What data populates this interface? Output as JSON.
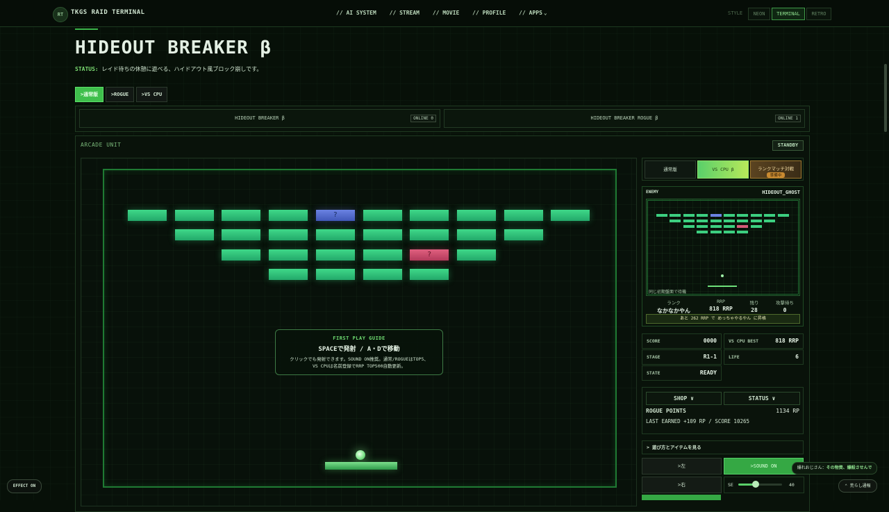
{
  "header": {
    "logo_badge": "RT",
    "site_name": "TKGS RAID TERMINAL",
    "nav": [
      "// AI SYSTEM",
      "// STREAM",
      "// MOVIE",
      "// PROFILE",
      "// APPS"
    ],
    "style_label": "STYLE",
    "style_options": [
      "NEON",
      "TERMINAL",
      "RETRO"
    ],
    "style_active": "TERMINAL"
  },
  "page": {
    "title": "HIDEOUT BREAKER β",
    "status_label": "STATUS:",
    "status_text": "レイド待ちの休憩に遊べる、ハイドアウト風ブロック崩しです。",
    "modes": [
      ">通常版",
      ">ROGUE",
      ">VS CPU"
    ],
    "active_mode": ">通常版"
  },
  "online": [
    {
      "name": "HIDEOUT BREAKER β",
      "badge": "ONLINE 0"
    },
    {
      "name": "HIDEOUT BREAKER ROGUE β",
      "badge": "ONLINE 1"
    }
  ],
  "arcade": {
    "title": "ARCADE UNIT",
    "state_badge": "STANDBY",
    "guide": {
      "heading": "FIRST PLAY GUIDE",
      "controls": "SPACEで発射 / A・Dで移動",
      "line1": "クリックでも発射できます。SOUND ON推奨。通常/ROGUEはTOP5、",
      "line2": "VS CPUは名前登録でRRP TOP500自動更新。"
    },
    "special_mark": "?"
  },
  "right_panel": {
    "tabs": [
      "通常版",
      "VS CPU β",
      "ランクマッチ対戦"
    ],
    "rank_sub": "準備中",
    "enemy_label": "ENEMY",
    "enemy_name": "HIDEOUT_GHOST",
    "minimap_note": "同じ初期盤面で待機",
    "enemy_stats": [
      {
        "label": "ランク",
        "value": "なかなかやん"
      },
      {
        "label": "RRP",
        "value": "818 RRP"
      },
      {
        "label": "残り",
        "value": "28"
      },
      {
        "label": "攻撃待ち",
        "value": "0"
      }
    ],
    "rank_progress": "あと 262 RRP で めっちゃやるやん に昇格",
    "stats": [
      {
        "label": "SCORE",
        "value": "0000"
      },
      {
        "label": "VS CPU BEST",
        "value": "818 RRP"
      },
      {
        "label": "STAGE",
        "value": "R1-1"
      },
      {
        "label": "LIFE",
        "value": "6"
      },
      {
        "label": "STATE",
        "value": "READY"
      }
    ],
    "shop_label": "SHOP ∨",
    "status_label": "STATUS ∨",
    "rogue_points_label": "ROGUE POINTS",
    "rogue_points_value": "1134 RP",
    "last_earned": "LAST EARNED +109 RP / SCORE 10265",
    "howto": "> 遊び方とアイテムを見る",
    "controls": {
      "left": ">左",
      "sound": ">SOUND ON",
      "right": ">右",
      "se_label": "SE",
      "se_value": "40",
      "se_level": 0.4
    }
  },
  "overlays": {
    "effect_toggle": "EFFECT ON",
    "toast_name": "爆れおじさん：",
    "toast_msg": "その物資、爆殺させんで",
    "report": "⌃ 荒らし通報"
  },
  "bricks": {
    "rows": [
      [
        "g",
        "g",
        "g",
        "g",
        "b",
        "g",
        "g",
        "g",
        "g",
        "g"
      ],
      [
        "",
        "g",
        "g",
        "g",
        "g",
        "g",
        "g",
        "g",
        "g",
        ""
      ],
      [
        "",
        "",
        "g",
        "g",
        "g",
        "g",
        "p",
        "g",
        "",
        ""
      ],
      [
        "",
        "",
        "",
        "g",
        "g",
        "g",
        "g",
        "",
        "",
        ""
      ]
    ]
  }
}
